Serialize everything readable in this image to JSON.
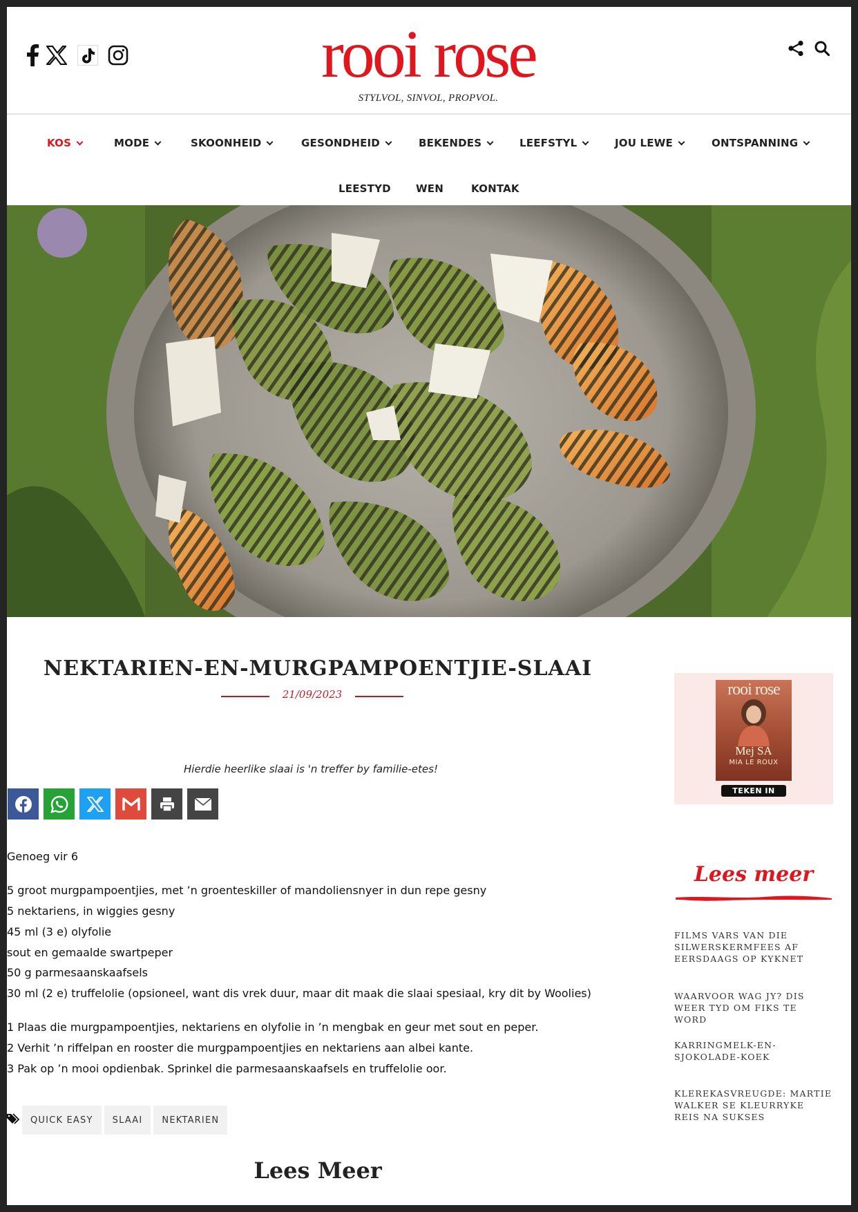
{
  "header": {
    "logo": "rooi rose",
    "tagline": "STYLVOL, SINVOL, PROPVOL."
  },
  "social_icons": [
    "facebook-icon",
    "x-icon",
    "tiktok-icon",
    "instagram-icon"
  ],
  "header_icons": [
    "share-icon",
    "search-icon"
  ],
  "nav": {
    "row1": [
      {
        "label": "KOS",
        "dropdown": true,
        "active": true
      },
      {
        "label": "MODE",
        "dropdown": true
      },
      {
        "label": "SKOONHEID",
        "dropdown": true
      },
      {
        "label": "GESONDHEID",
        "dropdown": true
      },
      {
        "label": "BEKENDES",
        "dropdown": true
      },
      {
        "label": "LEEFSTYL",
        "dropdown": true
      },
      {
        "label": "JOU LEWE",
        "dropdown": true
      },
      {
        "label": "ONTSPANNING",
        "dropdown": true
      }
    ],
    "row2": [
      {
        "label": "LEESTYD"
      },
      {
        "label": "WEN"
      },
      {
        "label": "KONTAK"
      }
    ]
  },
  "article": {
    "title": "NEKTARIEN-EN-MURGPAMPOENTJIE-SLAAI",
    "date": "21/09/2023",
    "intro": "Hierdie heerlike slaai is 'n treffer by familie-etes!",
    "serves": "Genoeg vir 6",
    "ingredients": [
      "5 groot murgpampoentjies, met ’n groenteskiller of mandoliensnyer in dun repe gesny",
      "5 nektariens, in wiggies gesny",
      "45 ml (3 e) olyfolie",
      "sout en gemaalde swartpeper",
      "50 g parmesaanskaafsels",
      "30 ml (2 e) truffelolie (opsioneel, want dis vrek duur, maar dit maak die slaai spesiaal, kry dit by Woolies)"
    ],
    "steps": [
      "1 Plaas die murgpampoentjies, nektariens en olyfolie in ’n mengbak en geur met sout en peper.",
      "2 Verhit ’n riffelpan en rooster die murgpampoentjies en nektariens aan albei kante.",
      "3 Pak op ’n mooi opdienbak. Sprinkel die parmesaanskaafsels en truffelolie oor."
    ],
    "tags": [
      "QUICK EASY",
      "SLAAI",
      "NEKTARIEN"
    ],
    "lees_meer": "Lees Meer"
  },
  "share_buttons": [
    {
      "name": "facebook",
      "color": "#3b5998"
    },
    {
      "name": "whatsapp",
      "color": "#25a336"
    },
    {
      "name": "x",
      "color": "#1da1f2"
    },
    {
      "name": "gmail",
      "color": "#e04a3a"
    },
    {
      "name": "print",
      "color": "#444444"
    },
    {
      "name": "email",
      "color": "#444444"
    }
  ],
  "sidebar": {
    "promo": {
      "magazine_brand": "rooi rose",
      "magazine_headline": "Mej SA",
      "magazine_name": "MIA LE ROUX",
      "button": "TEKEN IN"
    },
    "heading": "Lees meer",
    "links": [
      "FILMS VARS VAN DIE SILWERSKERMFEES AF EERSDAAGS OP KYKNET",
      "WAARVOOR WAG JY? DIS WEER TYD OM FIKS TE WORD",
      "KARRINGMELK-EN-SJOKOLADE-KOEK",
      "KLEREKASVREUGDE: MARTIE WALKER SE KLEURRYKE REIS NA SUKSES"
    ]
  },
  "colors": {
    "brand_red": "#e0161f",
    "date_red": "#c21d24",
    "promo_bg": "#fae9e6"
  }
}
